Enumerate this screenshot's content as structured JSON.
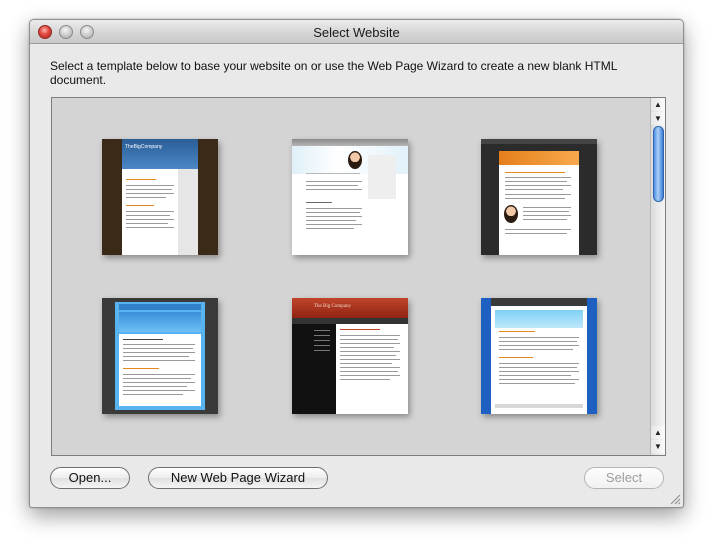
{
  "window": {
    "title": "Select Website"
  },
  "instruction": "Select a template below to base your website on or use the Web Page Wizard to create a new blank HTML document.",
  "templates": [
    {
      "caption": "TheBigCompany"
    },
    {
      "caption": ""
    },
    {
      "caption": ""
    },
    {
      "caption": ""
    },
    {
      "caption": "The Big Company"
    },
    {
      "caption": ""
    }
  ],
  "scrollbar": {
    "up_glyph": "▲",
    "down_glyph": "▼"
  },
  "buttons": {
    "open": "Open...",
    "wizard": "New Web Page Wizard",
    "select": "Select"
  },
  "icons": {
    "close": "close-icon",
    "minimize": "minimize-icon",
    "zoom": "zoom-icon",
    "grip": "resize-grip-icon"
  }
}
